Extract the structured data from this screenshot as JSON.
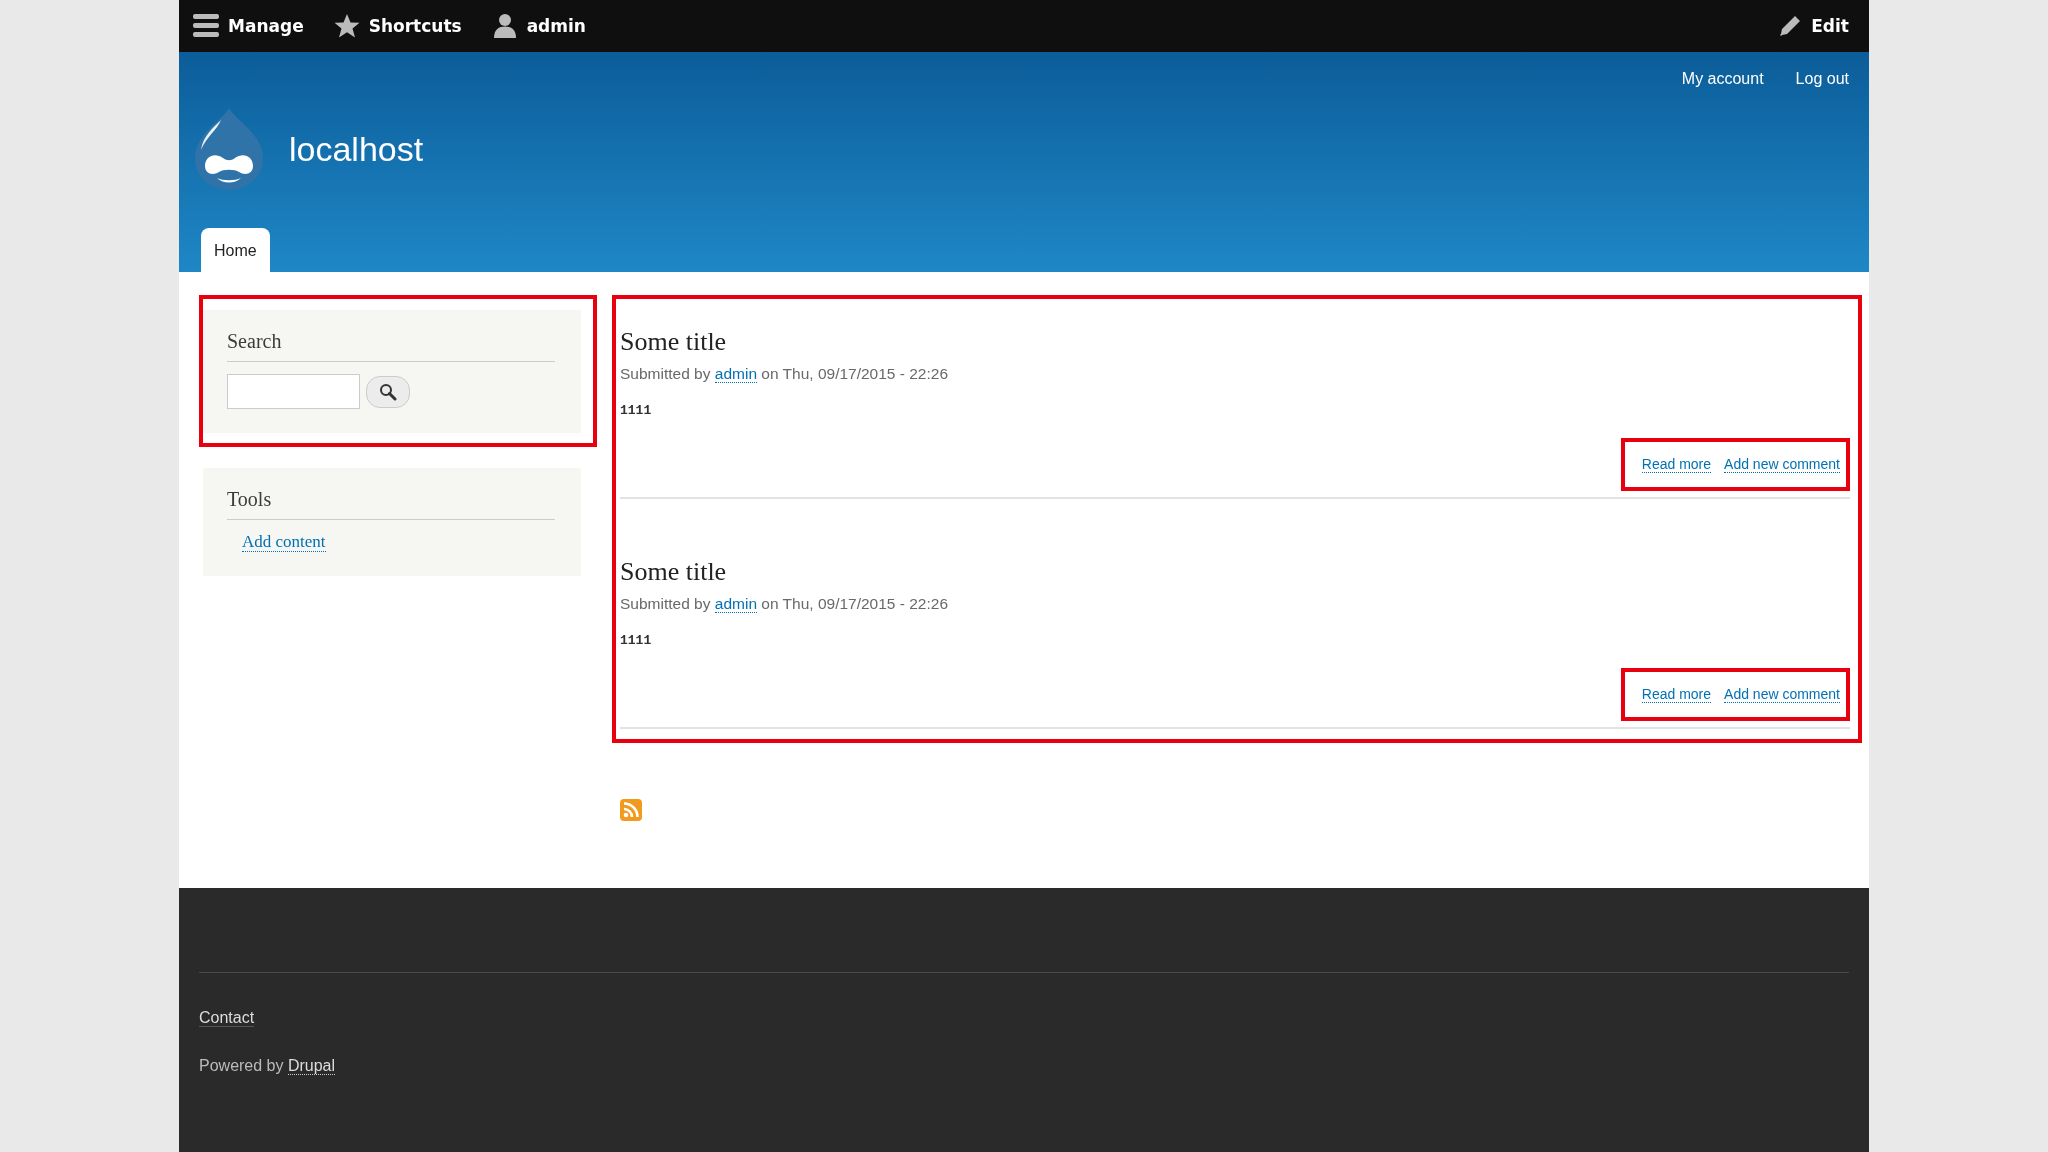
{
  "toolbar": {
    "items": [
      {
        "kind": "menu",
        "label": "Manage"
      },
      {
        "kind": "shortcuts",
        "label": "Shortcuts"
      },
      {
        "kind": "user",
        "label": "admin"
      }
    ],
    "edit": {
      "label": "Edit"
    }
  },
  "secondary_menu": [
    "My account",
    "Log out"
  ],
  "site": {
    "name": "localhost"
  },
  "tabs": [
    {
      "label": "Home",
      "selected": true
    }
  ],
  "sidebar": {
    "blocks": [
      {
        "kind": "search",
        "title": "Search",
        "highlighted": true
      },
      {
        "kind": "links",
        "title": "Tools",
        "links": [
          "Add content"
        ],
        "highlighted": false
      }
    ]
  },
  "main": {
    "highlighted": true,
    "articles": [
      {
        "title": "Some title",
        "submitted": {
          "prefix": "Submitted by",
          "author": "admin",
          "date": "on Thu, 09/17/2015 - 22:26"
        },
        "body": "1111",
        "links": [
          "Read more",
          "Add new comment"
        ],
        "links_highlighted": true
      },
      {
        "title": "Some title",
        "submitted": {
          "prefix": "Submitted by",
          "author": "admin",
          "date": "on Thu, 09/17/2015 - 22:26"
        },
        "body": "1111",
        "links": [
          "Read more",
          "Add new comment"
        ],
        "links_highlighted": true
      }
    ],
    "feed": {
      "kind": "rss"
    }
  },
  "footer": {
    "links": [
      "Contact"
    ],
    "powered_by": {
      "prefix": "Powered by",
      "link": "Drupal"
    }
  }
}
